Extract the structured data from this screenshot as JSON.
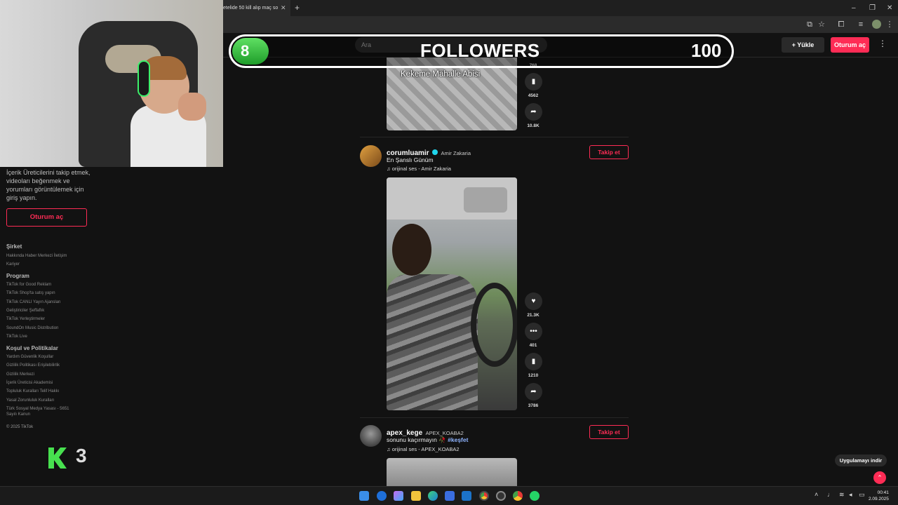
{
  "browser": {
    "tab_title": "etelide 50 kill alıp maç so",
    "tab_close": "✕",
    "new_tab": "+",
    "window_controls": [
      "–",
      "❐",
      "✕"
    ]
  },
  "overlay": {
    "followers_current": "8",
    "followers_title": "FOLLOWERS",
    "followers_goal": "100"
  },
  "header": {
    "search_placeholder": "Ara",
    "upload_label": "Yükle",
    "login_label": "Oturum aç",
    "more_icon": "⋮"
  },
  "sidebar": {
    "login_note": "İçerik Üreticilerini takip etmek, videoları beğenmek ve yorumları görüntülemek için giriş yapın.",
    "login_button": "Oturum aç",
    "sections": [
      {
        "title": "Şirket",
        "links": [
          "Hakkında  Haber Merkezi  İletişim",
          "Kariyer"
        ]
      },
      {
        "title": "Program",
        "links": [
          "TikTok for Good  Reklam",
          "TikTok Shop'ta satış yapın",
          "TikTok CANLI Yayın Ajansları",
          "Geliştiriciler  Şeffaflık",
          "TikTok Yerleştirmeler",
          "SoundOn Music Distribution",
          "TikTok Live"
        ]
      },
      {
        "title": "Koşul ve Politikalar",
        "links": [
          "Yardım  Güvenlik  Koşullar",
          "Gizlilik Politikası  Erişilebilirlik",
          "Gizlilik Merkezi",
          "İçerik Üreticisi Akademisi",
          "Topluluk Kuralları  Telif Hakkı",
          "Yasal Zorunluluk Kuralları",
          "Türk Sosyal Medya Yasası - 5651",
          "Sayılı Kanun"
        ]
      }
    ],
    "copyright": "© 2025 TikTok",
    "k3_number": "3"
  },
  "feed": {
    "post1": {
      "video_caption": "Kekeme Mahalle Abisi",
      "counts": [
        "768",
        "4562",
        "10.8K"
      ]
    },
    "post2": {
      "username": "corumluamir",
      "display_name": "Amir Zakaria",
      "description": "En Şanslı Günüm",
      "sound": "orijinal ses - Amir Zakaria",
      "follow_label": "Takip et",
      "counts": {
        "likes": "21.3K",
        "comments": "401",
        "saves": "1210",
        "shares": "3786"
      }
    },
    "post3": {
      "username": "apex_kege",
      "display_name": "APEX_KOABA2",
      "description": "sonunu kaçırmayın 🥀",
      "hashtag": "#keşfet",
      "sound": "orijinal ses - APEX_KOABA2",
      "follow_label": "Takip et"
    },
    "app_download": "Uygulamayı indir"
  },
  "taskbar": {
    "time": "00:41",
    "date": "2.09.2025"
  },
  "colors": {
    "accent": "#fe2c55",
    "background": "#121212",
    "overlay_green": "#3cc043"
  }
}
